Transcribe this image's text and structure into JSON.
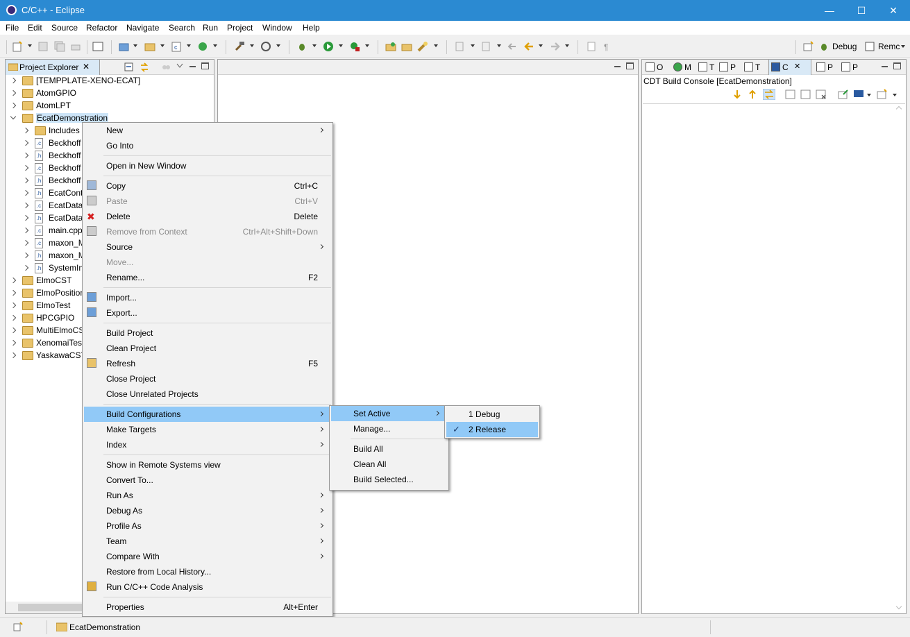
{
  "window": {
    "title": "C/C++ - Eclipse",
    "minimize": "—",
    "maximize": "☐",
    "close": "✕"
  },
  "menubar": [
    "File",
    "Edit",
    "Source",
    "Refactor",
    "Navigate",
    "Search",
    "Run",
    "Project",
    "Window",
    "Help"
  ],
  "perspectives": {
    "debug": "Debug",
    "remote": "Remc"
  },
  "project_explorer": {
    "tab_label": "Project Explorer",
    "items": [
      {
        "label": "[TEMPPLATE-XENO-ECAT]",
        "level": 0,
        "type": "project"
      },
      {
        "label": "AtomGPIO",
        "level": 0,
        "type": "project"
      },
      {
        "label": "AtomLPT",
        "level": 0,
        "type": "project"
      },
      {
        "label": "EcatDemonstration",
        "level": 0,
        "type": "project",
        "expanded": true
      },
      {
        "label": "Includes",
        "level": 1,
        "type": "includes"
      },
      {
        "label": "Beckhoff",
        "level": 1,
        "type": "c"
      },
      {
        "label": "Beckhoff",
        "level": 1,
        "type": "h"
      },
      {
        "label": "Beckhoff",
        "level": 1,
        "type": "c"
      },
      {
        "label": "Beckhoff",
        "level": 1,
        "type": "h"
      },
      {
        "label": "EcatCont",
        "level": 1,
        "type": "h"
      },
      {
        "label": "EcatData",
        "level": 1,
        "type": "c"
      },
      {
        "label": "EcatData",
        "level": 1,
        "type": "h"
      },
      {
        "label": "main.cpp",
        "level": 1,
        "type": "c"
      },
      {
        "label": "maxon_M",
        "level": 1,
        "type": "c"
      },
      {
        "label": "maxon_M",
        "level": 1,
        "type": "h"
      },
      {
        "label": "SystemIn",
        "level": 1,
        "type": "h"
      },
      {
        "label": "ElmoCST",
        "level": 0,
        "type": "project"
      },
      {
        "label": "ElmoPosition",
        "level": 0,
        "type": "project"
      },
      {
        "label": "ElmoTest",
        "level": 0,
        "type": "project"
      },
      {
        "label": "HPCGPIO",
        "level": 0,
        "type": "project"
      },
      {
        "label": "MultiElmoCS",
        "level": 0,
        "type": "project"
      },
      {
        "label": "XenomaiTest",
        "level": 0,
        "type": "project"
      },
      {
        "label": "YaskawaCST",
        "level": 0,
        "type": "project"
      }
    ]
  },
  "right_view": {
    "tabs": [
      "O",
      "M",
      "T",
      "P",
      "T",
      "C",
      "P",
      "P"
    ],
    "console_title": "CDT Build Console [EcatDemonstration]"
  },
  "context_menu": {
    "items": [
      {
        "label": "New",
        "submenu": true
      },
      {
        "label": "Go Into"
      },
      {
        "sep": true
      },
      {
        "label": "Open in New Window"
      },
      {
        "sep": true
      },
      {
        "label": "Copy",
        "shortcut": "Ctrl+C",
        "icon": "copy-icon"
      },
      {
        "label": "Paste",
        "shortcut": "Ctrl+V",
        "disabled": true,
        "icon": "paste-icon"
      },
      {
        "label": "Delete",
        "shortcut": "Delete",
        "icon": "delete-icon"
      },
      {
        "label": "Remove from Context",
        "shortcut": "Ctrl+Alt+Shift+Down",
        "disabled": true,
        "icon": "remove-context-icon"
      },
      {
        "label": "Source",
        "submenu": true
      },
      {
        "label": "Move...",
        "disabled": true
      },
      {
        "label": "Rename...",
        "shortcut": "F2"
      },
      {
        "sep": true
      },
      {
        "label": "Import...",
        "icon": "import-icon"
      },
      {
        "label": "Export...",
        "icon": "export-icon"
      },
      {
        "sep": true
      },
      {
        "label": "Build Project"
      },
      {
        "label": "Clean Project"
      },
      {
        "label": "Refresh",
        "shortcut": "F5",
        "icon": "refresh-icon"
      },
      {
        "label": "Close Project"
      },
      {
        "label": "Close Unrelated Projects"
      },
      {
        "sep": true
      },
      {
        "label": "Build Configurations",
        "submenu": true,
        "highlighted": true
      },
      {
        "label": "Make Targets",
        "submenu": true
      },
      {
        "label": "Index",
        "submenu": true
      },
      {
        "sep": true
      },
      {
        "label": "Show in Remote Systems view"
      },
      {
        "label": "Convert To..."
      },
      {
        "label": "Run As",
        "submenu": true
      },
      {
        "label": "Debug As",
        "submenu": true
      },
      {
        "label": "Profile As",
        "submenu": true
      },
      {
        "label": "Team",
        "submenu": true
      },
      {
        "label": "Compare With",
        "submenu": true
      },
      {
        "label": "Restore from Local History..."
      },
      {
        "label": "Run C/C++ Code Analysis",
        "icon": "code-analysis-icon"
      },
      {
        "sep": true
      },
      {
        "label": "Properties",
        "shortcut": "Alt+Enter"
      }
    ]
  },
  "build_config_menu": {
    "items": [
      {
        "label": "Set Active",
        "submenu": true,
        "highlighted": true
      },
      {
        "label": "Manage..."
      },
      {
        "sep": true
      },
      {
        "label": "Build All"
      },
      {
        "label": "Clean All"
      },
      {
        "label": "Build Selected..."
      }
    ]
  },
  "set_active_menu": {
    "items": [
      {
        "label": "1 Debug"
      },
      {
        "label": "2 Release",
        "checked": true,
        "highlighted": true
      }
    ]
  },
  "statusbar": {
    "selected": "EcatDemonstration"
  }
}
